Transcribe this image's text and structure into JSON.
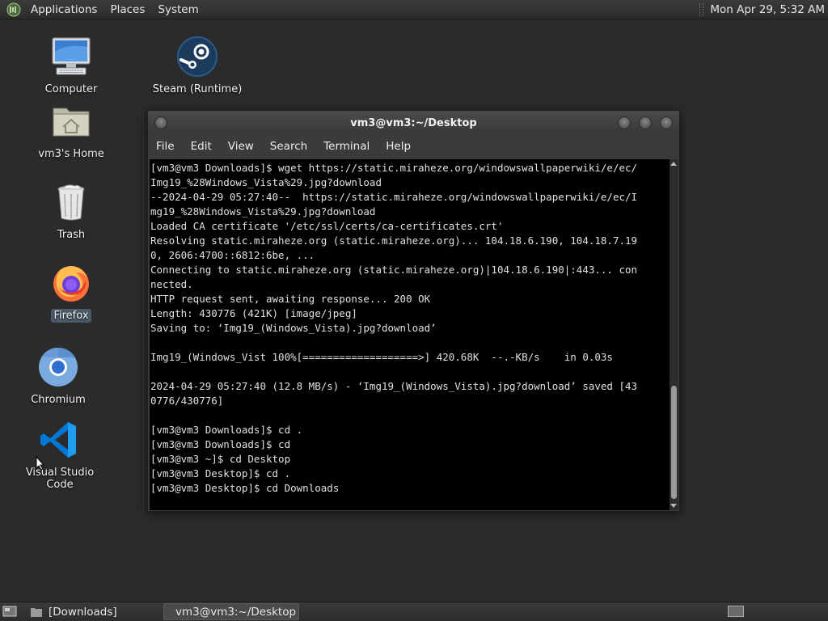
{
  "top_panel": {
    "menus": [
      "Applications",
      "Places",
      "System"
    ],
    "clock": "Mon Apr 29,  5:32 AM"
  },
  "desktop_icons": [
    {
      "label": "Computer",
      "icon": "computer-icon"
    },
    {
      "label": "Steam (Runtime)",
      "icon": "steam-icon"
    },
    {
      "label": "vm3's Home",
      "icon": "home-folder-icon"
    },
    {
      "label": "Trash",
      "icon": "trash-icon"
    },
    {
      "label": "Firefox",
      "icon": "firefox-icon"
    },
    {
      "label": "Chromium",
      "icon": "chromium-icon"
    },
    {
      "label": "Visual Studio Code",
      "icon": "vscode-icon"
    }
  ],
  "terminal": {
    "title": "vm3@vm3:~/Desktop",
    "menus": [
      "File",
      "Edit",
      "View",
      "Search",
      "Terminal",
      "Help"
    ],
    "lines": [
      "[vm3@vm3 Downloads]$ wget https://static.miraheze.org/windowswallpaperwiki/e/ec/",
      "Img19_%28Windows_Vista%29.jpg?download",
      "--2024-04-29 05:27:40--  https://static.miraheze.org/windowswallpaperwiki/e/ec/I",
      "mg19_%28Windows_Vista%29.jpg?download",
      "Loaded CA certificate '/etc/ssl/certs/ca-certificates.crt'",
      "Resolving static.miraheze.org (static.miraheze.org)... 104.18.6.190, 104.18.7.19",
      "0, 2606:4700::6812:6be, ...",
      "Connecting to static.miraheze.org (static.miraheze.org)|104.18.6.190|:443... con",
      "nected.",
      "HTTP request sent, awaiting response... 200 OK",
      "Length: 430776 (421K) [image/jpeg]",
      "Saving to: ‘Img19_(Windows_Vista).jpg?download’",
      "",
      "Img19_(Windows_Vist 100%[===================>] 420.68K  --.-KB/s    in 0.03s",
      "",
      "2024-04-29 05:27:40 (12.8 MB/s) - ‘Img19_(Windows_Vista).jpg?download’ saved [43",
      "0776/430776]",
      "",
      "[vm3@vm3 Downloads]$ cd .",
      "[vm3@vm3 Downloads]$ cd",
      "[vm3@vm3 ~]$ cd Desktop",
      "[vm3@vm3 Desktop]$ cd .",
      "[vm3@vm3 Desktop]$ cd Downloads"
    ]
  },
  "taskbar": {
    "items": [
      {
        "label": "[Downloads]",
        "icon": "folder-icon",
        "active": false
      },
      {
        "label": "vm3@vm3:~/Desktop",
        "icon": "terminal-icon",
        "active": true
      }
    ]
  },
  "colors": {
    "desktop_bg": "#2b2b2b",
    "terminal_bg": "#000000",
    "terminal_fg": "#e0e0e0",
    "panel_bg": "#333333"
  }
}
